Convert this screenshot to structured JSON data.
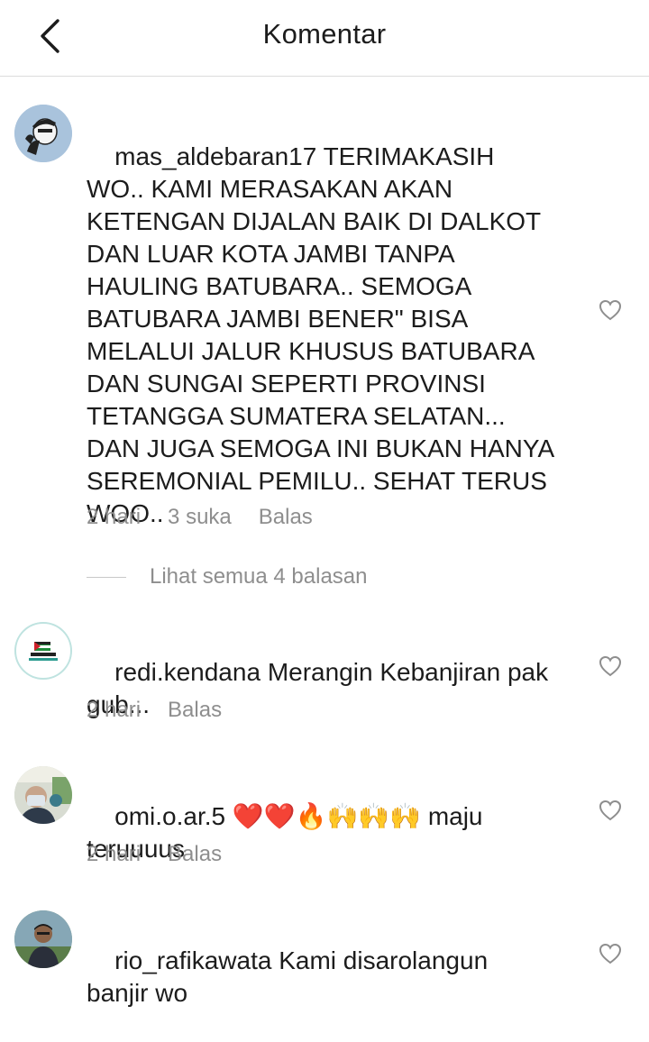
{
  "header": {
    "title": "Komentar",
    "back_icon": "chevron-left-icon"
  },
  "comments": [
    {
      "username": "mas_aldebaran17",
      "text": "TERIMAKASIH WO.. KAMI MERASAKAN AKAN KETENGAN DIJALAN BAIK DI DALKOT DAN LUAR KOTA JAMBI TANPA HAULING BATUBARA.. SEMOGA BATUBARA JAMBI BENER\" BISA MELALUI JALUR KHUSUS BATUBARA DAN SUNGAI SEPERTI PROVINSI TETANGGA SUMATERA SELATAN... DAN JUGA SEMOGA INI BUKAN HANYA SEREMONIAL PEMILU.. SEHAT TERUS WOO..",
      "time": "2 hari",
      "likes": "3 suka",
      "reply": "Balas",
      "view_replies": "Lihat semua 4 balasan"
    },
    {
      "username": "redi.kendana",
      "text": "Merangin Kebanjiran pak gub...",
      "time": "2 hari",
      "reply": "Balas"
    },
    {
      "username": "omi.o.ar.5",
      "text": "❤️❤️🔥🙌🙌🙌 maju teruuuus",
      "time": "2 hari",
      "reply": "Balas"
    },
    {
      "username": "rio_rafikawata",
      "text": "Kami disarolangun banjir wo"
    }
  ],
  "colors": {
    "secondary_text": "#8e8e8e",
    "divider": "#dcdcdc"
  }
}
